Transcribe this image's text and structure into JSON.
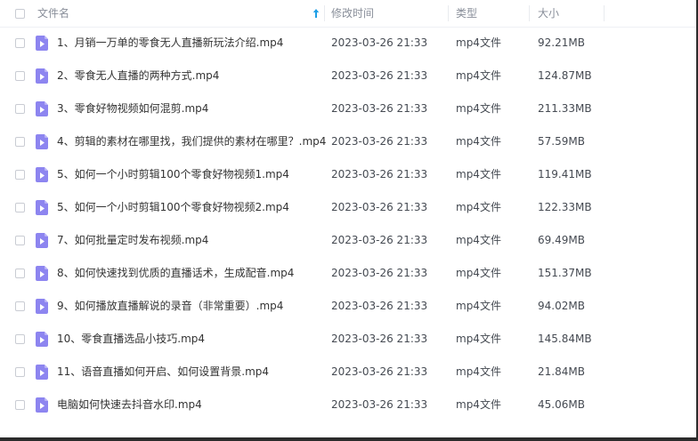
{
  "header": {
    "name_label": "文件名",
    "mtime_label": "修改时间",
    "type_label": "类型",
    "size_label": "大小",
    "sort_icon": "arrow-up-icon",
    "accent_color": "#1e9fe6"
  },
  "file_icon": "video-file-icon",
  "file_icon_color": "#8d85f0",
  "files": [
    {
      "name": "1、月销一万单的零食无人直播新玩法介绍.mp4",
      "mtime": "2023-03-26 21:33",
      "type": "mp4文件",
      "size": "92.21MB"
    },
    {
      "name": "2、零食无人直播的两种方式.mp4",
      "mtime": "2023-03-26 21:33",
      "type": "mp4文件",
      "size": "124.87MB"
    },
    {
      "name": "3、零食好物视频如何混剪.mp4",
      "mtime": "2023-03-26 21:33",
      "type": "mp4文件",
      "size": "211.33MB"
    },
    {
      "name": "4、剪辑的素材在哪里找，我们提供的素材在哪里？.mp4",
      "mtime": "2023-03-26 21:33",
      "type": "mp4文件",
      "size": "57.59MB"
    },
    {
      "name": "5、如何一个小时剪辑100个零食好物视频1.mp4",
      "mtime": "2023-03-26 21:33",
      "type": "mp4文件",
      "size": "119.41MB"
    },
    {
      "name": "5、如何一个小时剪辑100个零食好物视频2.mp4",
      "mtime": "2023-03-26 21:33",
      "type": "mp4文件",
      "size": "122.33MB"
    },
    {
      "name": "7、如何批量定时发布视频.mp4",
      "mtime": "2023-03-26 21:33",
      "type": "mp4文件",
      "size": "69.49MB"
    },
    {
      "name": "8、如何快速找到优质的直播话术，生成配音.mp4",
      "mtime": "2023-03-26 21:33",
      "type": "mp4文件",
      "size": "151.37MB"
    },
    {
      "name": "9、如何播放直播解说的录音（非常重要）.mp4",
      "mtime": "2023-03-26 21:33",
      "type": "mp4文件",
      "size": "94.02MB"
    },
    {
      "name": "10、零食直播选品小技巧.mp4",
      "mtime": "2023-03-26 21:33",
      "type": "mp4文件",
      "size": "145.84MB"
    },
    {
      "name": "11、语音直播如何开启、如何设置背景.mp4",
      "mtime": "2023-03-26 21:33",
      "type": "mp4文件",
      "size": "21.84MB"
    },
    {
      "name": "电脑如何快速去抖音水印.mp4",
      "mtime": "2023-03-26 21:33",
      "type": "mp4文件",
      "size": "45.06MB"
    }
  ]
}
